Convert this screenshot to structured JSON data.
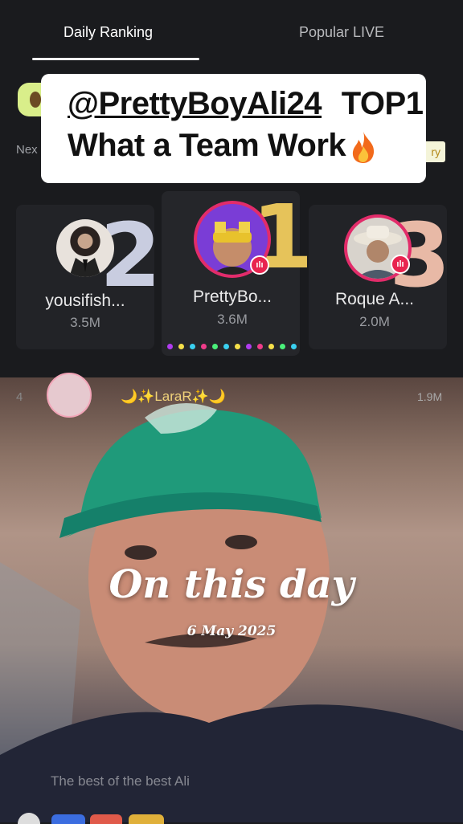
{
  "tabs": [
    {
      "label": "Daily Ranking",
      "active": true
    },
    {
      "label": "Popular LIVE",
      "active": false
    }
  ],
  "caption": {
    "handle": "@PrettyBoyAli24",
    "rank_text": "TOP1",
    "line2": "What a Team Work",
    "emoji": "fire-icon"
  },
  "next_label_partial": "Nex",
  "tag_partial": "ry",
  "ranking": [
    {
      "rank": "2",
      "name": "yousifish...",
      "score": "3.5M",
      "number_color": "#c9cde0"
    },
    {
      "rank": "1",
      "name": "PrettyBo...",
      "score": "3.6M",
      "number_color": "#e6c35a"
    },
    {
      "rank": "3",
      "name": "Roque A...",
      "score": "2.0M",
      "number_color": "#e8b9a6"
    }
  ],
  "row4": {
    "rank": "4",
    "name": "🌙✨LaraR✨🌙",
    "score": "1.9M"
  },
  "overlay": {
    "title": "On this day",
    "date": "6 May 2025"
  },
  "comment": "The best of the best Ali",
  "colors": {
    "live": "#e8244f",
    "accent_ring": "#e22c6a"
  }
}
